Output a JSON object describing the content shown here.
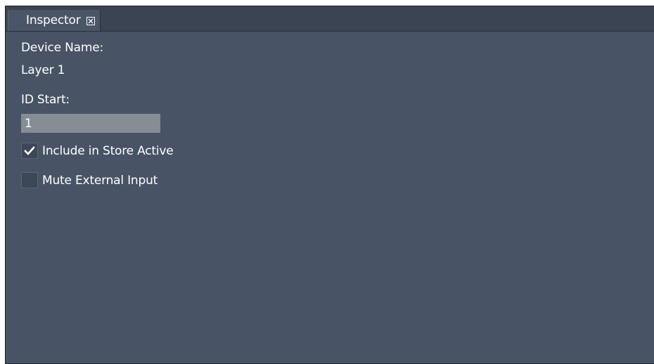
{
  "tab": {
    "label": "Inspector",
    "close_icon": "close-box-icon"
  },
  "fields": {
    "device_name_label": "Device Name:",
    "device_name_value": "Layer 1",
    "id_start_label": "ID Start:",
    "id_start_value": "1"
  },
  "checkboxes": [
    {
      "label": "Include in Store Active",
      "checked": true
    },
    {
      "label": "Mute External Input",
      "checked": false
    }
  ],
  "colors": {
    "panel_background": "#485365",
    "tab_bar": "#3a4452",
    "input_background": "#858d95",
    "text": "#ffffff"
  }
}
